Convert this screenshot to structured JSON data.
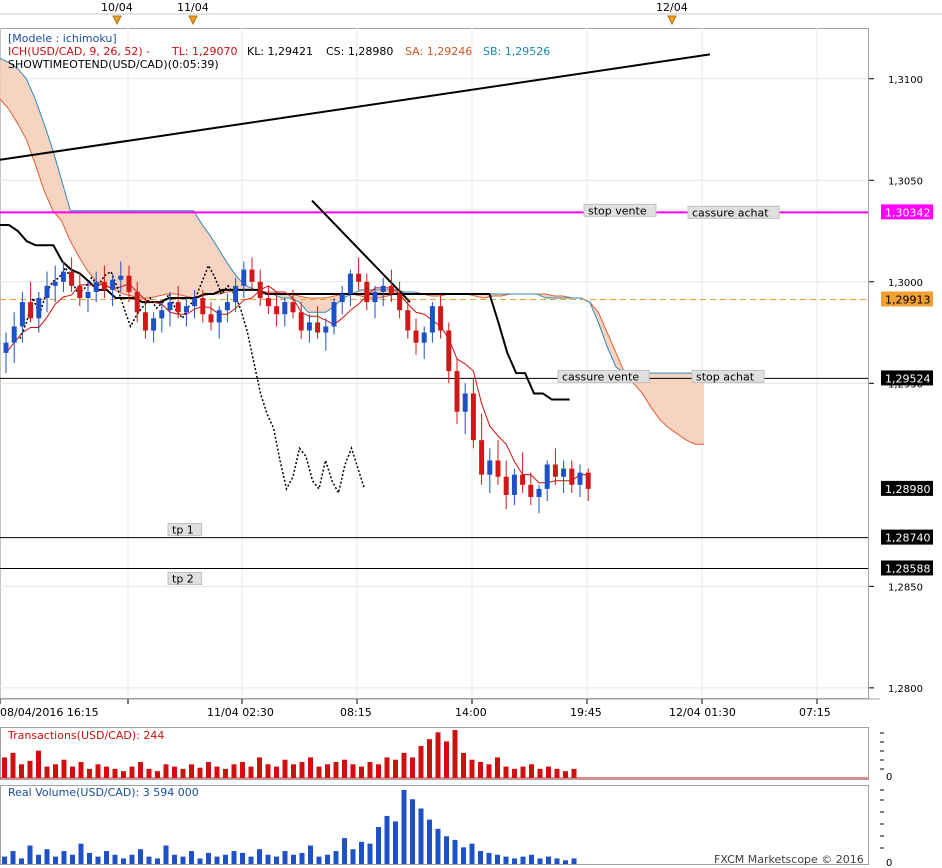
{
  "chart_data": {
    "type": "candlestick",
    "instrument": "USD/CAD",
    "date_flags": [
      "10/04",
      "11/04",
      "12/04"
    ],
    "x_ticks": [
      "08/04/2016 16:15",
      "11/04 02:30",
      "08:15",
      "14:00",
      "19:45",
      "12/04 01:30",
      "07:15"
    ],
    "y_ticks": [
      "1,3100",
      "1,3050",
      "1,3000",
      "1,2950",
      "1,2850",
      "1,2800"
    ],
    "ylim": [
      1.2795,
      1.3125
    ],
    "legend_lines": {
      "model": "[Modele : ichimoku]",
      "ich_prefix": "ICH(USD/CAD, 9, 26, 52) -",
      "tl": "TL: 1,29070",
      "kl": "KL: 1,29421",
      "cs": "CS: 1,28980",
      "sa": "SA: 1,29246",
      "sb": "SB: 1,29526",
      "showtime": "SHOWTIMEOTEND(USD/CAD)(0:05:39)"
    },
    "price_tags": [
      {
        "label": "1,30342",
        "value": 1.30342,
        "color": "#ff00ff"
      },
      {
        "label": "1,29913",
        "value": 1.29913,
        "color": "#f0a030"
      },
      {
        "label": "1,29524",
        "value": 1.29524,
        "color": "#000000"
      },
      {
        "label": "1,28980",
        "value": 1.2898,
        "color": "#000000"
      },
      {
        "label": "1,28740",
        "value": 1.2874,
        "color": "#000000"
      },
      {
        "label": "1,28588",
        "value": 1.28588,
        "color": "#000000"
      }
    ],
    "level_labels": [
      {
        "label": "stop vente",
        "value": 1.30342
      },
      {
        "label": "cassure achat",
        "value": 1.30342
      },
      {
        "label": "cassure vente",
        "value": 1.29524
      },
      {
        "label": "stop achat",
        "value": 1.29524
      },
      {
        "label": "tp 1",
        "value": 1.2874
      },
      {
        "label": "tp 2",
        "value": 1.28588
      }
    ],
    "trend_line": [
      {
        "x": 0,
        "y": 1.3065
      },
      {
        "x": 150,
        "y": 1.3115
      }
    ],
    "candles": [
      [
        1.2965,
        1.2975,
        1.2955,
        1.297
      ],
      [
        1.297,
        1.2985,
        1.296,
        1.2978
      ],
      [
        1.2978,
        1.2995,
        1.297,
        1.299
      ],
      [
        1.299,
        1.3,
        1.298,
        1.2982
      ],
      [
        1.2982,
        1.2995,
        1.2975,
        1.2992
      ],
      [
        1.2992,
        1.3005,
        1.2985,
        1.2998
      ],
      [
        1.2998,
        1.3008,
        1.299,
        1.3
      ],
      [
        1.3,
        1.301,
        1.2995,
        1.3005
      ],
      [
        1.3005,
        1.3012,
        1.2995,
        1.2998
      ],
      [
        1.2998,
        1.3005,
        1.2988,
        1.2992
      ],
      [
        1.2992,
        1.3,
        1.2985,
        1.2995
      ],
      [
        1.2995,
        1.3005,
        1.299,
        1.3
      ],
      [
        1.3,
        1.3008,
        1.2992,
        1.2996
      ],
      [
        1.2996,
        1.3004,
        1.2988,
        1.3001
      ],
      [
        1.3001,
        1.301,
        1.2995,
        1.3003
      ],
      [
        1.3003,
        1.3008,
        1.299,
        1.2995
      ],
      [
        1.2995,
        1.3,
        1.298,
        1.2985
      ],
      [
        1.2985,
        1.2992,
        1.2972,
        1.2976
      ],
      [
        1.2976,
        1.2985,
        1.297,
        1.2982
      ],
      [
        1.2982,
        1.299,
        1.2975,
        1.2986
      ],
      [
        1.2986,
        1.2995,
        1.2978,
        1.299
      ],
      [
        1.299,
        1.2998,
        1.2982,
        1.2985
      ],
      [
        1.2985,
        1.2992,
        1.2978,
        1.2988
      ],
      [
        1.2988,
        1.2996,
        1.2982,
        1.2992
      ],
      [
        1.2992,
        1.2996,
        1.298,
        1.2984
      ],
      [
        1.2984,
        1.299,
        1.2976,
        1.298
      ],
      [
        1.298,
        1.2988,
        1.2972,
        1.2986
      ],
      [
        1.2986,
        1.2994,
        1.298,
        1.299
      ],
      [
        1.299,
        1.3002,
        1.2985,
        1.2998
      ],
      [
        1.2998,
        1.301,
        1.2992,
        1.3006
      ],
      [
        1.3006,
        1.3012,
        1.2996,
        1.3
      ],
      [
        1.3,
        1.3006,
        1.2988,
        1.2992
      ],
      [
        1.2992,
        1.2998,
        1.2984,
        1.2988
      ],
      [
        1.2988,
        1.2994,
        1.2978,
        1.2984
      ],
      [
        1.2984,
        1.2992,
        1.2978,
        1.299
      ],
      [
        1.299,
        1.2996,
        1.2982,
        1.2985
      ],
      [
        1.2985,
        1.299,
        1.2972,
        1.2976
      ],
      [
        1.2976,
        1.2984,
        1.297,
        1.298
      ],
      [
        1.298,
        1.2988,
        1.2972,
        1.2975
      ],
      [
        1.2975,
        1.2982,
        1.2966,
        1.2978
      ],
      [
        1.2978,
        1.2992,
        1.2974,
        1.299
      ],
      [
        1.299,
        1.2998,
        1.2984,
        1.2994
      ],
      [
        1.2994,
        1.3006,
        1.2988,
        1.3004
      ],
      [
        1.3004,
        1.3012,
        1.2996,
        1.3
      ],
      [
        1.3,
        1.3004,
        1.2986,
        1.299
      ],
      [
        1.299,
        1.2998,
        1.2982,
        1.2995
      ],
      [
        1.2995,
        1.3002,
        1.2988,
        1.2998
      ],
      [
        1.2998,
        1.3006,
        1.299,
        1.2994
      ],
      [
        1.2994,
        1.3,
        1.2982,
        1.2986
      ],
      [
        1.2986,
        1.2992,
        1.2972,
        1.2976
      ],
      [
        1.2976,
        1.2982,
        1.2964,
        1.297
      ],
      [
        1.297,
        1.2978,
        1.2962,
        1.2975
      ],
      [
        1.2975,
        1.299,
        1.297,
        1.2988
      ],
      [
        1.2988,
        1.2994,
        1.2972,
        1.2976
      ],
      [
        1.2976,
        1.298,
        1.295,
        1.2956
      ],
      [
        1.2956,
        1.2962,
        1.293,
        1.2936
      ],
      [
        1.2936,
        1.295,
        1.2925,
        1.2945
      ],
      [
        1.2945,
        1.2952,
        1.2918,
        1.2922
      ],
      [
        1.2922,
        1.2935,
        1.29,
        1.2905
      ],
      [
        1.2905,
        1.2918,
        1.2896,
        1.2912
      ],
      [
        1.2912,
        1.2922,
        1.29,
        1.2904
      ],
      [
        1.2904,
        1.2912,
        1.2888,
        1.2895
      ],
      [
        1.2895,
        1.2908,
        1.289,
        1.2905
      ],
      [
        1.2905,
        1.2916,
        1.2896,
        1.29
      ],
      [
        1.29,
        1.2906,
        1.289,
        1.2894
      ],
      [
        1.2894,
        1.29,
        1.2886,
        1.2898
      ],
      [
        1.2898,
        1.2912,
        1.2892,
        1.291
      ],
      [
        1.291,
        1.2918,
        1.29,
        1.2904
      ],
      [
        1.2904,
        1.2912,
        1.2896,
        1.2908
      ],
      [
        1.2908,
        1.2912,
        1.2896,
        1.29
      ],
      [
        1.29,
        1.291,
        1.2894,
        1.2906
      ],
      [
        1.2906,
        1.2908,
        1.2892,
        1.2898
      ]
    ],
    "kijun": [
      1.3028,
      1.3028,
      1.3025,
      1.302,
      1.3018,
      1.3018,
      1.3018,
      1.301,
      1.3006,
      1.3004,
      1.3,
      1.2996,
      1.2996,
      1.2992,
      1.2992,
      1.2992,
      1.299,
      1.299,
      1.299,
      1.2992,
      1.2992,
      1.2992,
      1.2992,
      1.2994,
      1.2994,
      1.2996,
      1.2996,
      1.2996,
      1.2996,
      1.2996,
      1.2994,
      1.2994,
      1.2994,
      1.2994,
      1.2994,
      1.2994,
      1.2994,
      1.2994,
      1.2994,
      1.2994,
      1.2994,
      1.2994,
      1.2994,
      1.2994,
      1.2994,
      1.2994,
      1.2994,
      1.2994,
      1.2994,
      1.2994,
      1.2994,
      1.2994,
      1.2994,
      1.2994,
      1.2994,
      1.2994,
      1.298,
      1.2965,
      1.2955,
      1.2955,
      1.2945,
      1.2945,
      1.2942,
      1.2942,
      1.2942
    ],
    "tenkan_offset": [
      0.0012,
      0.001,
      0.0006,
      0.0004,
      0.0002
    ],
    "chikou_end": [
      1.2998,
      1.2994,
      1.2986,
      1.2975,
      1.296,
      1.2945,
      1.2935,
      1.2928,
      1.2912,
      1.2898,
      1.2904,
      1.2918,
      1.2914,
      1.2902,
      1.2898,
      1.2912,
      1.2902,
      1.2896,
      1.291,
      1.2918,
      1.2908,
      1.2898
    ],
    "senkou_a": [
      1.309,
      1.3085,
      1.3078,
      1.307,
      1.3058,
      1.3045,
      1.3035,
      1.303,
      1.302,
      1.3012,
      1.3005,
      1.3,
      1.2998,
      1.2996,
      1.2994,
      1.2993,
      1.2992,
      1.2992,
      1.2993,
      1.2994,
      1.2994,
      1.2993,
      1.2992,
      1.2993,
      1.2994,
      1.2994,
      1.2995,
      1.2996,
      1.2996,
      1.2996,
      1.2995,
      1.2995,
      1.2994,
      1.2994,
      1.2993,
      1.2992,
      1.2992,
      1.2992,
      1.2993,
      1.2994,
      1.2994,
      1.2993,
      1.2992,
      1.2992,
      1.2993,
      1.2994,
      1.2995,
      1.2995,
      1.2994,
      1.2993,
      1.2993,
      1.2994,
      1.2994,
      1.2994,
      1.2993,
      1.2992,
      1.2993,
      1.2993,
      1.2994,
      1.2994,
      1.2994,
      1.2994,
      1.2994,
      1.2993,
      1.2993,
      1.2992,
      1.2992,
      1.299,
      1.2985,
      1.2975,
      1.2965,
      1.2955,
      1.295,
      1.2945,
      1.2938,
      1.2932,
      1.2928,
      1.2925,
      1.2922,
      1.292,
      1.292
    ],
    "senkou_b": [
      1.311,
      1.3108,
      1.3105,
      1.31,
      1.309,
      1.3078,
      1.3065,
      1.305,
      1.3035,
      1.3035,
      1.3035,
      1.3035,
      1.3035,
      1.3035,
      1.3035,
      1.3035,
      1.3035,
      1.3035,
      1.3035,
      1.3035,
      1.3035,
      1.3035,
      1.3035,
      1.3028,
      1.3022,
      1.3015,
      1.3008,
      1.3002,
      1.2998,
      1.2996,
      1.2994,
      1.2994,
      1.2992,
      1.2992,
      1.299,
      1.2985,
      1.2985,
      1.2985,
      1.2988,
      1.2992,
      1.2994,
      1.2996,
      1.2996,
      1.2996,
      1.2996,
      1.2996,
      1.2995,
      1.2995,
      1.2994,
      1.2994,
      1.2994,
      1.2994,
      1.2994,
      1.2994,
      1.2994,
      1.2994,
      1.2994,
      1.2994,
      1.2994,
      1.2994,
      1.2994,
      1.2994,
      1.2992,
      1.2992,
      1.2992,
      1.2992,
      1.2992,
      1.299,
      1.298,
      1.2968,
      1.2958,
      1.2955,
      1.2955,
      1.2955,
      1.2955,
      1.2955,
      1.2955,
      1.2955,
      1.2955,
      1.2955,
      1.2955
    ],
    "transactions_label": "Transactions(USD/CAD): 244",
    "transactions": [
      18,
      22,
      12,
      15,
      24,
      10,
      12,
      16,
      10,
      14,
      8,
      12,
      10,
      8,
      6,
      10,
      14,
      8,
      6,
      12,
      10,
      8,
      12,
      9,
      14,
      10,
      8,
      12,
      14,
      10,
      18,
      12,
      10,
      16,
      12,
      14,
      18,
      10,
      12,
      14,
      16,
      12,
      10,
      14,
      12,
      18,
      16,
      22,
      18,
      28,
      34,
      40,
      32,
      42,
      22,
      16,
      14,
      12,
      18,
      10,
      8,
      10,
      12,
      8,
      10,
      8,
      6,
      8
    ],
    "volume_label": "Real Volume(USD/CAD): 3 594 000",
    "volume": [
      8,
      14,
      6,
      20,
      10,
      16,
      8,
      14,
      10,
      22,
      12,
      8,
      14,
      10,
      6,
      10,
      16,
      8,
      6,
      20,
      10,
      8,
      14,
      6,
      12,
      8,
      10,
      14,
      12,
      8,
      16,
      10,
      8,
      14,
      10,
      12,
      20,
      8,
      10,
      14,
      28,
      16,
      24,
      22,
      40,
      52,
      46,
      80,
      70,
      60,
      48,
      38,
      30,
      26,
      18,
      22,
      14,
      12,
      10,
      8,
      6,
      8,
      10,
      6,
      8,
      6,
      4,
      6
    ],
    "copyright": "FXCM Marketscope © 2016"
  }
}
